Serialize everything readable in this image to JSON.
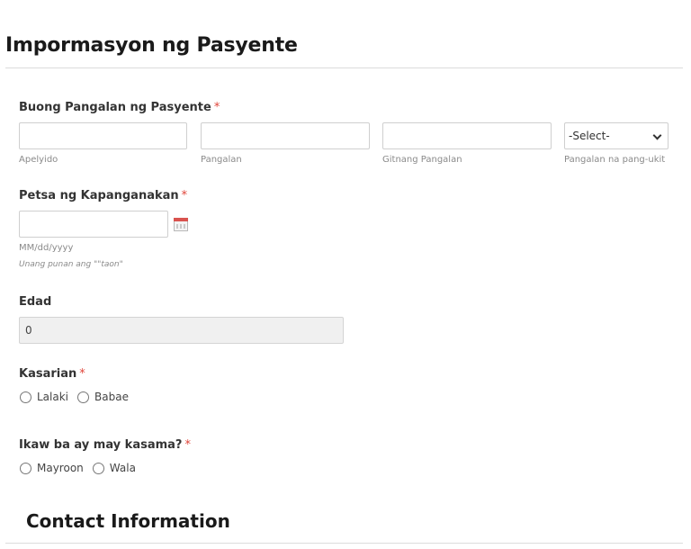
{
  "section1": {
    "title": "Impormasyon ng Pasyente"
  },
  "full_name": {
    "label": "Buong Pangalan ng Pasyente",
    "required_mark": "*",
    "last_name_value": "",
    "first_name_value": "",
    "middle_name_value": "",
    "suffix_selected": "-Select-",
    "sublabels": {
      "last": "Apelyido",
      "first": "Pangalan",
      "middle": "Gitnang Pangalan",
      "suffix": "Pangalan na pang-ukit"
    }
  },
  "birth_date": {
    "label": "Petsa ng Kapanganakan",
    "required_mark": "*",
    "value": "",
    "format_hint": "MM/dd/yyyy",
    "note": "Unang punan ang \"\"taon\"",
    "icon": "calendar-icon"
  },
  "age": {
    "label": "Edad",
    "value": "0"
  },
  "sex": {
    "label": "Kasarian",
    "required_mark": "*",
    "options": [
      "Lalaki",
      "Babae"
    ]
  },
  "companion": {
    "label": "Ikaw ba ay may kasama?",
    "required_mark": "*",
    "options": [
      "Mayroon",
      "Wala"
    ]
  },
  "section2": {
    "title": "Contact Information"
  },
  "colors": {
    "required": "#e0453a",
    "border": "#cfcfcf",
    "readonly_bg": "#f0f0f0"
  }
}
